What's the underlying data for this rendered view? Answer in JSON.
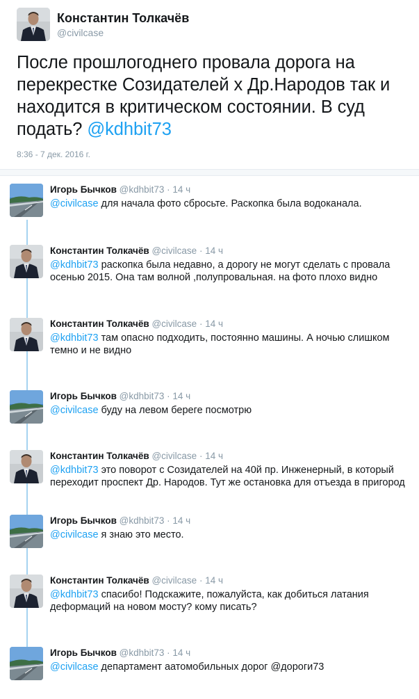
{
  "main_tweet": {
    "author_name": "Константин Толкачёв",
    "author_handle": "@civilcase",
    "text": "После прошлогоднего провала дорога на перекрестке Созидателей х Др.Народов так и находится в критическом состоянии. В суд подать? ",
    "mention": "@kdhbit73",
    "timestamp": "8:36 - 7 дек. 2016 г."
  },
  "replies": [
    {
      "name": "Игорь Бычков",
      "handle": "@kdhbit73",
      "time": "14 ч",
      "mention": "@civilcase",
      "text": " для начала фото сбросьте. Раскопка была водоканала.",
      "avatar": "road"
    },
    {
      "name": "Константин Толкачёв",
      "handle": "@civilcase",
      "time": "14 ч",
      "mention": "@kdhbit73",
      "text": " раскопка была недавно, а дорогу не могут сделать с провала осенью 2015. Она там волной ,полупровальная. на фото плохо видно",
      "avatar": "person"
    },
    {
      "name": "Константин Толкачёв",
      "handle": "@civilcase",
      "time": "14 ч",
      "mention": "@kdhbit73",
      "text": " там опасно подходить, постоянно машины. А ночью слишком темно и не видно",
      "avatar": "person"
    },
    {
      "name": "Игорь Бычков",
      "handle": "@kdhbit73",
      "time": "14 ч",
      "mention": "@civilcase",
      "text": " буду на левом береге посмотрю",
      "avatar": "road"
    },
    {
      "name": "Константин Толкачёв",
      "handle": "@civilcase",
      "time": "14 ч",
      "mention": "@kdhbit73",
      "text": " это поворот с Созидателей на 40й пр. Инженерный, в который переходит проспект Др. Народов. Тут же остановка для отъезда в пригород",
      "avatar": "person"
    },
    {
      "name": "Игорь Бычков",
      "handle": "@kdhbit73",
      "time": "14 ч",
      "mention": "@civilcase",
      "text": " я знаю это место.",
      "avatar": "road"
    },
    {
      "name": "Константин Толкачёв",
      "handle": "@civilcase",
      "time": "14 ч",
      "mention": "@kdhbit73",
      "text": " спасибо! Подскажите, пожалуйста, как добиться латания деформаций на новом мосту? кому писать?",
      "avatar": "person"
    },
    {
      "name": "Игорь Бычков",
      "handle": "@kdhbit73",
      "time": "14 ч",
      "mention": "@civilcase",
      "text": " департамент аатомобильных дорог @дороги73",
      "avatar": "road"
    }
  ],
  "separator": " · ",
  "colors": {
    "link": "#1da1f2",
    "muted": "#8899a6",
    "text": "#14171a",
    "thread_line": "#a5d3f0"
  }
}
